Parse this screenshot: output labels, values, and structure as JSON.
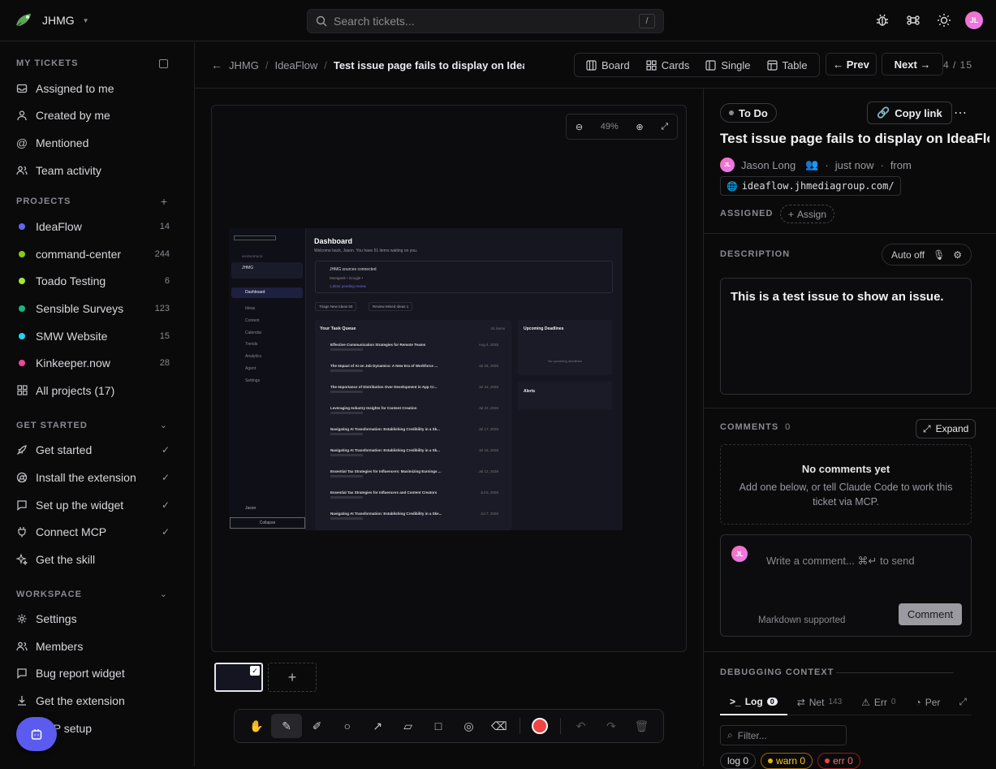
{
  "topbar": {
    "workspace": "JHMG",
    "search_placeholder": "Search tickets...",
    "search_shortcut": "/",
    "avatar_initials": "JL"
  },
  "sidebar": {
    "my_tickets_title": "MY TICKETS",
    "my_tickets": [
      {
        "label": "Assigned to me",
        "icon": "inbox-icon"
      },
      {
        "label": "Created by me",
        "icon": "user-icon"
      },
      {
        "label": "Mentioned",
        "icon": "at-icon"
      },
      {
        "label": "Team activity",
        "icon": "users-icon"
      }
    ],
    "projects_title": "PROJECTS",
    "projects": [
      {
        "label": "IdeaFlow",
        "count": "14",
        "color": "#6366f1"
      },
      {
        "label": "command-center",
        "count": "244",
        "color": "#84cc16"
      },
      {
        "label": "Toado Testing",
        "count": "6",
        "color": "#a3e635"
      },
      {
        "label": "Sensible Surveys",
        "count": "123",
        "color": "#10b981"
      },
      {
        "label": "SMW Website",
        "count": "15",
        "color": "#22d3ee"
      },
      {
        "label": "Kinkeeper.now",
        "count": "28",
        "color": "#ec4899"
      }
    ],
    "all_projects": "All projects (17)",
    "get_started_title": "GET STARTED",
    "get_started": [
      {
        "label": "Get started",
        "icon": "rocket-icon",
        "done": true
      },
      {
        "label": "Install the extension",
        "icon": "chrome-icon",
        "done": true
      },
      {
        "label": "Set up the widget",
        "icon": "message-icon",
        "done": true
      },
      {
        "label": "Connect MCP",
        "icon": "plug-icon",
        "done": true
      },
      {
        "label": "Get the skill",
        "icon": "sparkle-icon",
        "done": false
      }
    ],
    "workspace_title": "WORKSPACE",
    "workspace": [
      {
        "label": "Settings",
        "icon": "gear-icon"
      },
      {
        "label": "Members",
        "icon": "users-icon"
      },
      {
        "label": "Bug report widget",
        "icon": "message-icon"
      },
      {
        "label": "Get the extension",
        "icon": "download-icon"
      },
      {
        "label": "MCP setup",
        "icon": "plug-icon"
      }
    ]
  },
  "header": {
    "crumbs": [
      "JHMG",
      "IdeaFlow"
    ],
    "current": "Test issue page fails to display on IdeaFlow",
    "views": [
      "Board",
      "Cards",
      "Single",
      "Table"
    ],
    "prev": "Prev",
    "next": "Next",
    "pager": "4 / 15"
  },
  "canvas": {
    "zoom": "49%"
  },
  "ticket": {
    "status": "To Do",
    "copy_link": "Copy link",
    "title": "Test issue page fails to display on IdeaFlow",
    "author": "Jason Long",
    "author_initials": "JL",
    "time": "just now",
    "from": "from",
    "url": "ideaflow.jhmediagroup.com/",
    "assigned_label": "ASSIGNED",
    "assign": "Assign",
    "description_label": "DESCRIPTION",
    "auto_off": "Auto off",
    "description": "This is a test issue to show an issue.",
    "comments_label": "COMMENTS",
    "comments_count": "0",
    "expand": "Expand",
    "no_comments_title": "No comments yet",
    "no_comments_body": "Add one below, or tell Claude Code to work this ticket via MCP.",
    "comment_placeholder": "Write a comment... ⌘↵ to send",
    "markdown": "Markdown supported",
    "comment_btn": "Comment",
    "debug_label": "DEBUGGING CONTEXT",
    "debug_tabs": [
      {
        "label": "Log",
        "count": "0"
      },
      {
        "label": "Net",
        "count": "143"
      },
      {
        "label": "Err",
        "count": "0"
      },
      {
        "label": "Per",
        "count": ""
      }
    ],
    "filter_placeholder": "Filter...",
    "chips": [
      "log 0",
      "warn 0",
      "err 0"
    ]
  },
  "shot": {
    "sidebar_items": [
      "WORKSPACE",
      "JHMG",
      "Dashboard",
      "Ideas",
      "Content",
      "Calendar",
      "Trends",
      "Analytics",
      "Agent",
      "Settings",
      "Jason",
      "Collapse"
    ],
    "title": "Dashboard",
    "subtitle": "Welcome back, Jason. You have 51 items waiting on you.",
    "sources": "JHMG sources connected",
    "sources_sub": "Meetgeek • Google •",
    "pending": "1,8k82 pending review",
    "chip1": "Triage New Ideas 50",
    "chip2": "Review Mined Ideas 1",
    "queue_title": "Your Task Queue",
    "queue_count": "51 items",
    "deadlines": "Upcoming Deadlines",
    "no_deadlines": "No upcoming deadlines",
    "alerts": "Alerts",
    "tasks": [
      {
        "t": "Effective Communication Strategies for Remote Teams",
        "d": "Aug 4, 2026"
      },
      {
        "t": "The Impact of AI on Job Dynamics: A New Era of Workforce ...",
        "d": "Jul 25, 2026"
      },
      {
        "t": "The Importance of Distribution Over Development in App Cr...",
        "d": "Jul 22, 2026"
      },
      {
        "t": "Leveraging Industry Insights for Content Creation",
        "d": "Jul 22, 2026"
      },
      {
        "t": "Navigating AI Transformation: Establishing Credibility in a Sk...",
        "d": "Jul 17, 2026"
      },
      {
        "t": "Navigating AI Transformation: Establishing Credibility in a Sk...",
        "d": "Jul 16, 2026"
      },
      {
        "t": "Essential Tax Strategies for Influencers: Maximizing Earnings ...",
        "d": "Jul 12, 2026"
      },
      {
        "t": "Essential Tax Strategies for Influencers and Content Creators",
        "d": "Jul 8, 2026"
      },
      {
        "t": "Navigating AI Transformation: Establishing Credibility in a Ske...",
        "d": "Jul 7, 2026"
      }
    ]
  }
}
